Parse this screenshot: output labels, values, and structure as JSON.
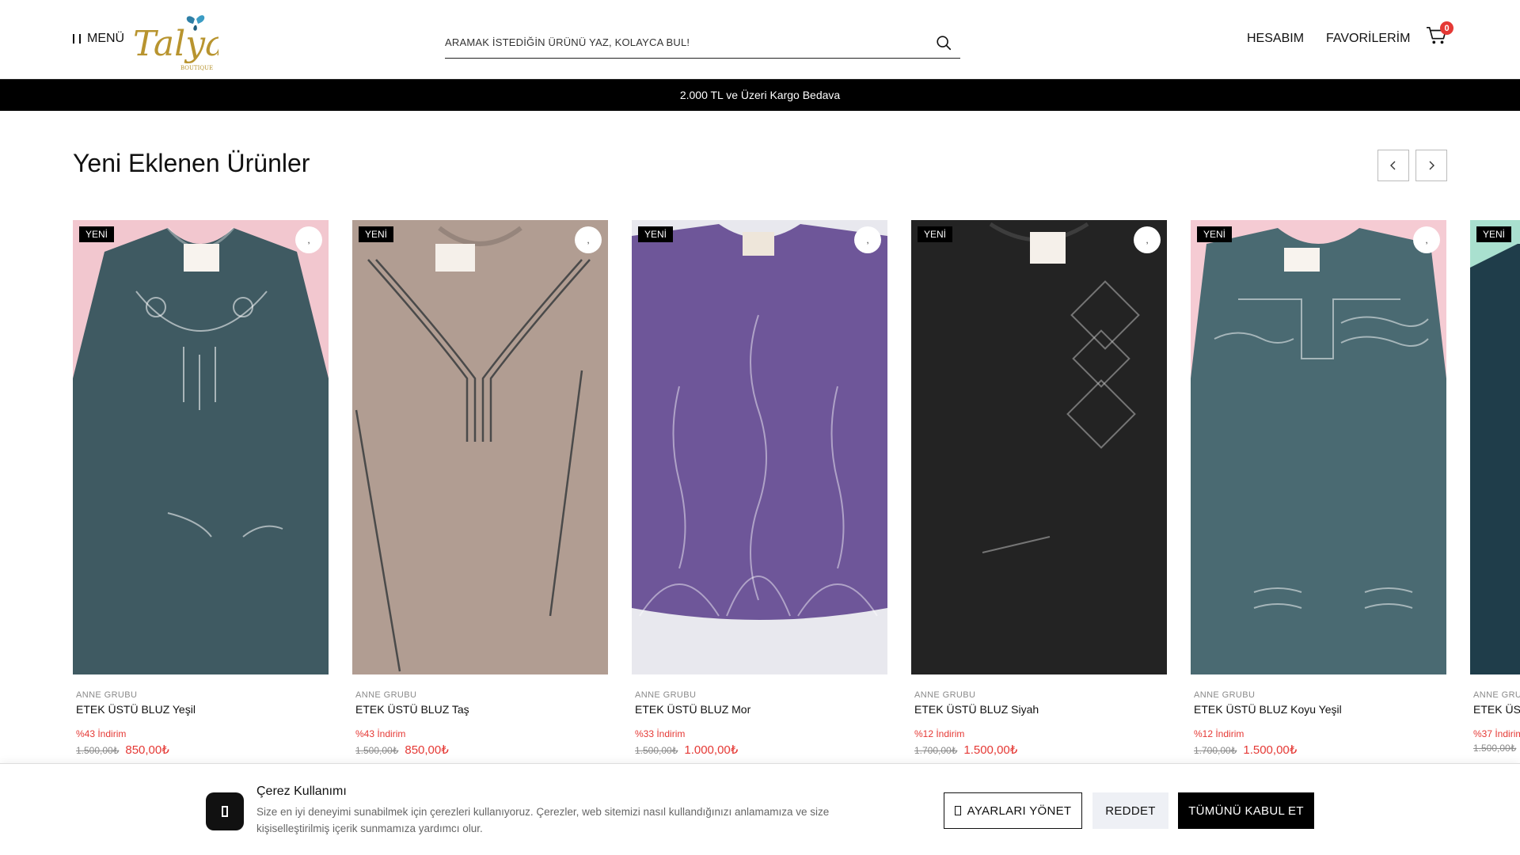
{
  "header": {
    "menu_label": "MENÜ",
    "logo_text": "Talya",
    "logo_sub": "BOUTIQUE",
    "search_placeholder": "ARAMAK İSTEDİĞİN ÜRÜNÜ YAZ, KOLAYCA BUL!",
    "account_label": "HESABIM",
    "favorites_label": "FAVORİLERİM",
    "cart_count": "0"
  },
  "announcement": "2.000 TL ve Üzeri Kargo Bedava",
  "section": {
    "title": "Yeni Eklenen Ürünler"
  },
  "products": [
    {
      "badge": "YENİ",
      "fav": ",",
      "brand": "ANNE GRUBU",
      "name": "ETEK ÜSTÜ BLUZ Yeşil",
      "discount": "%43 İndirim",
      "old_price": "1.500,00₺",
      "price": "850,00₺",
      "color": "#3f5a62",
      "bg": "#f2c7cf"
    },
    {
      "badge": "YENİ",
      "fav": ",",
      "brand": "ANNE GRUBU",
      "name": "ETEK ÜSTÜ BLUZ Taş",
      "discount": "%43 İndirim",
      "old_price": "1.500,00₺",
      "price": "850,00₺",
      "color": "#b19d92",
      "bg": "#c7b6ab"
    },
    {
      "badge": "YENİ",
      "fav": ",",
      "brand": "ANNE GRUBU",
      "name": "ETEK ÜSTÜ BLUZ Mor",
      "discount": "%33 İndirim",
      "old_price": "1.500,00₺",
      "price": "1.000,00₺",
      "color": "#6e5699",
      "bg": "#e8e8ee"
    },
    {
      "badge": "YENİ",
      "fav": ",",
      "brand": "ANNE GRUBU",
      "name": "ETEK ÜSTÜ BLUZ Siyah",
      "discount": "%12 İndirim",
      "old_price": "1.700,00₺",
      "price": "1.500,00₺",
      "color": "#232323",
      "bg": "#2a2a2a"
    },
    {
      "badge": "YENİ",
      "fav": ",",
      "brand": "ANNE GRUBU",
      "name": "ETEK ÜSTÜ BLUZ Koyu Yeşil",
      "discount": "%12 İndirim",
      "old_price": "1.700,00₺",
      "price": "1.500,00₺",
      "color": "#4a6a72",
      "bg": "#f5cbd3"
    },
    {
      "badge": "YENİ",
      "fav": ",",
      "brand": "ANNE GRUBU",
      "name": "ETEK ÜSTÜ BLUZ",
      "discount": "%37 İndirim",
      "old_price": "1.500,00₺",
      "price": "",
      "color": "#1f3d4a",
      "bg": "#a9e0cf"
    }
  ],
  "cookie": {
    "title": "Çerez Kullanımı",
    "text": "Size en iyi deneyimi sunabilmek için çerezleri kullanıyoruz. Çerezler, web sitemizi nasıl kullandığınızı anlamamıza ve size kişiselleştirilmiş içerik sunmamıza yardımcı olur.",
    "settings_label": "AYARLARI YÖNET",
    "reject_label": "REDDET",
    "accept_label": "TÜMÜNÜ KABUL ET"
  },
  "colors": {
    "accent_red": "#e53935",
    "bar_black": "#000000",
    "logo_gold": "#b8942f"
  }
}
